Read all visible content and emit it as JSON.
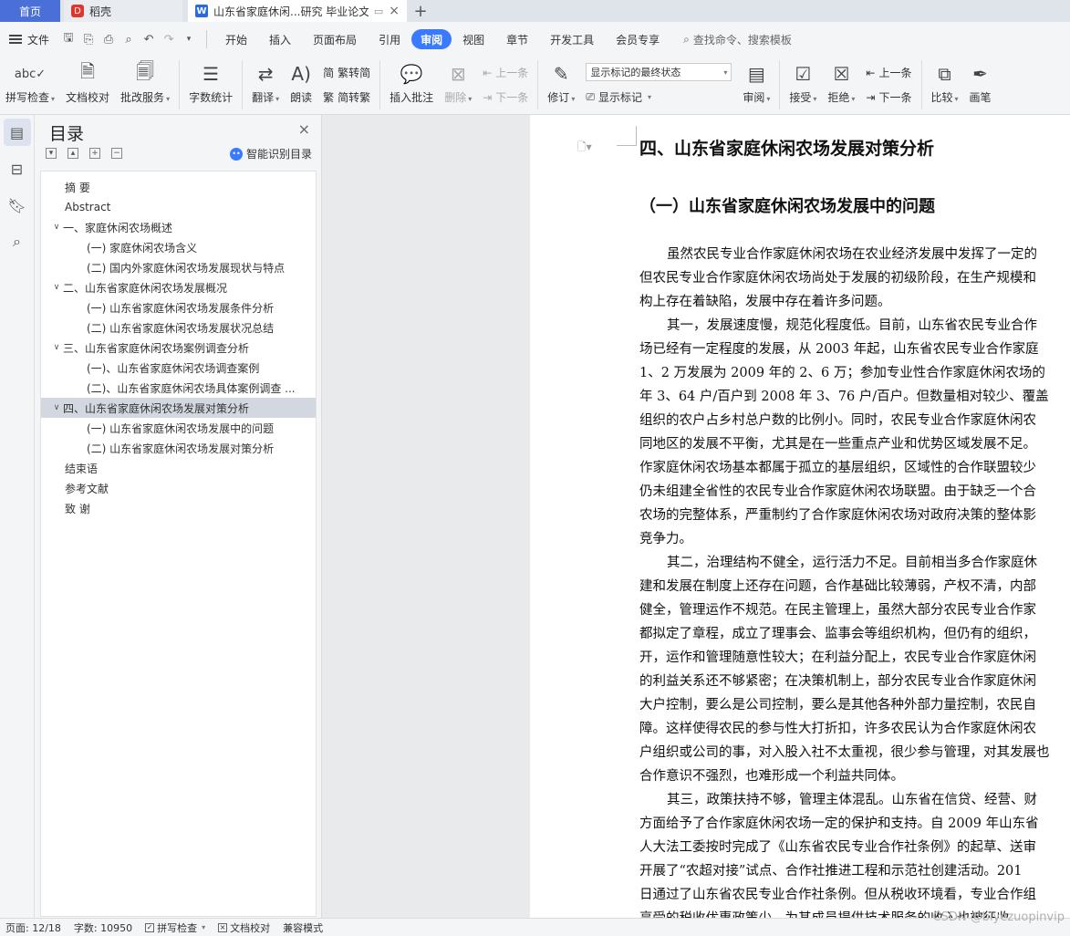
{
  "tabs": {
    "home": "首页",
    "daoke": "稻壳",
    "doc": "山东省家庭休闲...研究 毕业论文",
    "daoke_logo": "D",
    "doc_logo": "W"
  },
  "menu": {
    "file": "文件",
    "items": [
      "开始",
      "插入",
      "页面布局",
      "引用",
      "审阅",
      "视图",
      "章节",
      "开发工具",
      "会员专享"
    ],
    "active_index": 4,
    "search": "查找命令、搜索模板"
  },
  "ribbon": {
    "spell_check": "拼写检查",
    "doc_proof": "文档校对",
    "review_service": "批改服务",
    "word_count": "字数统计",
    "translate": "翻译",
    "read_aloud": "朗读",
    "trad_simp": "繁转简",
    "simp_trad": "简转繁",
    "insert_comment": "插入批注",
    "delete": "删除",
    "prev": "上一条",
    "next": "下一条",
    "revise": "修订",
    "markup_state": "显示标记的最终状态",
    "show_markup": "显示标记",
    "review": "审阅",
    "accept": "接受",
    "reject": "拒绝",
    "prev2": "上一条",
    "next2": "下一条",
    "compare": "比较",
    "ink": "画笔"
  },
  "toc": {
    "title": "目录",
    "smart": "智能识别目录",
    "items": [
      {
        "text": "摘    要",
        "level": 1
      },
      {
        "text": "Abstract",
        "level": 1
      },
      {
        "text": "一、家庭休闲农场概述",
        "level": 0
      },
      {
        "text": "(一) 家庭休闲农场含义",
        "level": 2
      },
      {
        "text": "(二) 国内外家庭休闲农场发展现状与特点",
        "level": 2
      },
      {
        "text": "二、山东省家庭休闲农场发展概况",
        "level": 0
      },
      {
        "text": "(一) 山东省家庭休闲农场发展条件分析",
        "level": 2
      },
      {
        "text": "(二) 山东省家庭休闲农场发展状况总结",
        "level": 2
      },
      {
        "text": "三、山东省家庭休闲农场案例调查分析",
        "level": 0
      },
      {
        "text": "(一)、山东省家庭休闲农场调查案例",
        "level": 2
      },
      {
        "text": "(二)、山东省家庭休闲农场具体案例调查 ...",
        "level": 2
      },
      {
        "text": "四、山东省家庭休闲农场发展对策分析",
        "level": 0
      },
      {
        "text": "(一) 山东省家庭休闲农场发展中的问题",
        "level": 2
      },
      {
        "text": "(二) 山东省家庭休闲农场发展对策分析",
        "level": 2
      },
      {
        "text": "结束语",
        "level": 1
      },
      {
        "text": "参考文献",
        "level": 1
      },
      {
        "text": "致    谢",
        "level": 1
      }
    ],
    "selected_index": 11
  },
  "document": {
    "heading1": "四、山东省家庭休闲农场发展对策分析",
    "heading2": "（一）山东省家庭休闲农场发展中的问题",
    "lines": [
      {
        "text": "虽然农民专业合作家庭休闲农场在农业经济发展中发挥了一定的",
        "indent": true
      },
      {
        "text": "但农民专业合作家庭休闲农场尚处于发展的初级阶段，在生产规模和",
        "indent": false
      },
      {
        "text": "构上存在着缺陷，发展中存在着许多问题。",
        "indent": false
      },
      {
        "text": "其一，发展速度慢，规范化程度低。目前，山东省农民专业合作",
        "indent": true
      },
      {
        "text": "场已经有一定程度的发展，从 2003 年起，山东省农民专业合作家庭",
        "indent": false
      },
      {
        "text": "1、2 万发展为 2009 年的 2、6 万；参加专业性合作家庭休闲农场的",
        "indent": false
      },
      {
        "text": "年 3、64 户/百户到 2008 年 3、76 户/百户。但数量相对较少、覆盖",
        "indent": false
      },
      {
        "text": "组织的农户占乡村总户数的比例小。同时，农民专业合作家庭休闲农",
        "indent": false
      },
      {
        "text": "同地区的发展不平衡，尤其是在一些重点产业和优势区域发展不足。",
        "indent": false
      },
      {
        "text": "作家庭休闲农场基本都属于孤立的基层组织，区域性的合作联盟较少",
        "indent": false
      },
      {
        "text": "仍未组建全省性的农民专业合作家庭休闲农场联盟。由于缺乏一个合",
        "indent": false
      },
      {
        "text": "农场的完整体系，严重制约了合作家庭休闲农场对政府决策的整体影",
        "indent": false
      },
      {
        "text": "竞争力。",
        "indent": false
      },
      {
        "text": "其二，治理结构不健全，运行活力不足。目前相当多合作家庭休",
        "indent": true
      },
      {
        "text": "建和发展在制度上还存在问题，合作基础比较薄弱，产权不清，内部",
        "indent": false
      },
      {
        "text": "健全，管理运作不规范。在民主管理上，虽然大部分农民专业合作家",
        "indent": false
      },
      {
        "text": "都拟定了章程，成立了理事会、监事会等组织机构，但仍有的组织，",
        "indent": false
      },
      {
        "text": "开，运作和管理随意性较大；在利益分配上，农民专业合作家庭休闲",
        "indent": false
      },
      {
        "text": "的利益关系还不够紧密；在决策机制上，部分农民专业合作家庭休闲",
        "indent": false
      },
      {
        "text": "大户控制，要么是公司控制，要么是其他各种外部力量控制，农民自",
        "indent": false
      },
      {
        "text": "障。这样使得农民的参与性大打折扣，许多农民认为合作家庭休闲农",
        "indent": false
      },
      {
        "text": "户组织或公司的事，对入股入社不太重视，很少参与管理，对其发展也",
        "indent": false
      },
      {
        "text": "合作意识不强烈，也难形成一个利益共同体。",
        "indent": false
      },
      {
        "text": "其三，政策扶持不够，管理主体混乱。山东省在信贷、经营、财",
        "indent": true
      },
      {
        "text": "方面给予了合作家庭休闲农场一定的保护和支持。自 2009 年山东省",
        "indent": false
      },
      {
        "text": "人大法工委按时完成了《山东省农民专业合作社条例》的起草、送审",
        "indent": false
      },
      {
        "text": "开展了“农超对接”试点、合作社推进工程和示范社创建活动。201",
        "indent": false
      },
      {
        "text": "日通过了山东省农民专业合作社条例。但从税收环境看，专业合作组",
        "indent": false
      },
      {
        "text": "享受的税收优惠政策少，为其成员提供技术服务的收入也被征收",
        "indent": false
      }
    ]
  },
  "status": {
    "page": "页面: 12/18",
    "words": "字数: 10950",
    "spell": "拼写检查",
    "proof": "文档校对",
    "compat": "兼容模式"
  },
  "watermark": "CSDN @biyezuopinvip"
}
